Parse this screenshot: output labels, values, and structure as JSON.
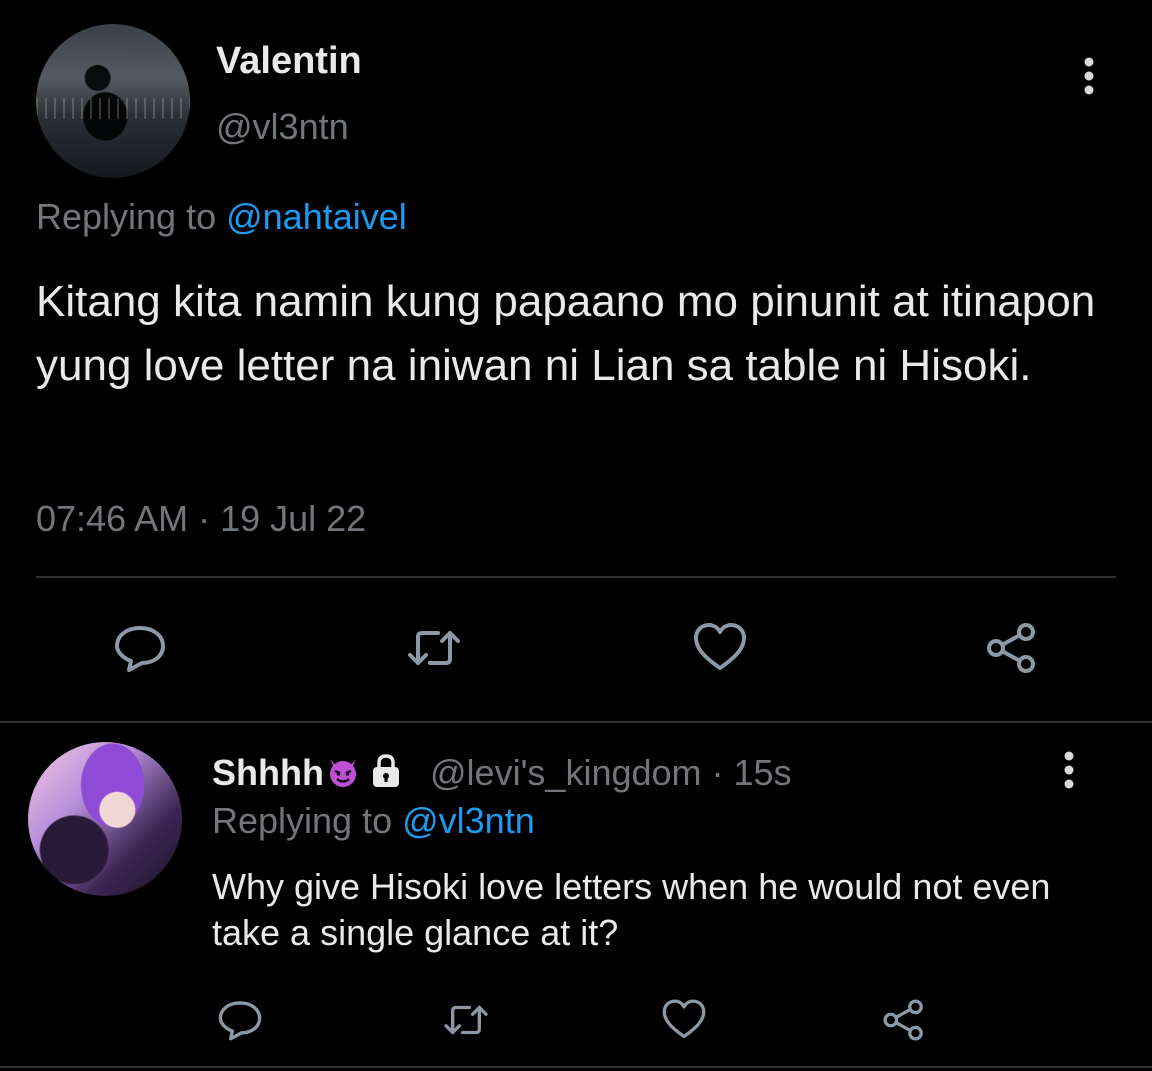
{
  "main_tweet": {
    "author_name": "Valentin",
    "author_handle": "@vl3ntn",
    "replying_prefix": "Replying to ",
    "replying_handle": "@nahtaivel",
    "text": "Kitang kita namin kung papaano mo pinunit at itinapon yung love letter na iniwan ni Lian sa table ni Hisoki.",
    "timestamp": "07:46 AM · 19 Jul 22",
    "actions": [
      "reply-icon",
      "retweet-icon",
      "like-icon",
      "share-icon"
    ]
  },
  "reply_tweet": {
    "author_name": "Shhhh",
    "author_emoji": "😈",
    "handle_meta": "@levi's_kingdom · 15s",
    "replying_prefix": "Replying to ",
    "replying_handle": "@vl3ntn",
    "text": "Why give Hisoki love letters when he would not even take a single glance at it?",
    "actions": [
      "reply-icon",
      "retweet-icon",
      "like-icon",
      "share-icon"
    ]
  },
  "colors": {
    "background": "#000000",
    "text_primary": "#e7e9ea",
    "text_secondary": "#71767b",
    "link": "#1d9bf0",
    "divider": "#2f3336",
    "devil_emoji": "#c04fd8"
  }
}
